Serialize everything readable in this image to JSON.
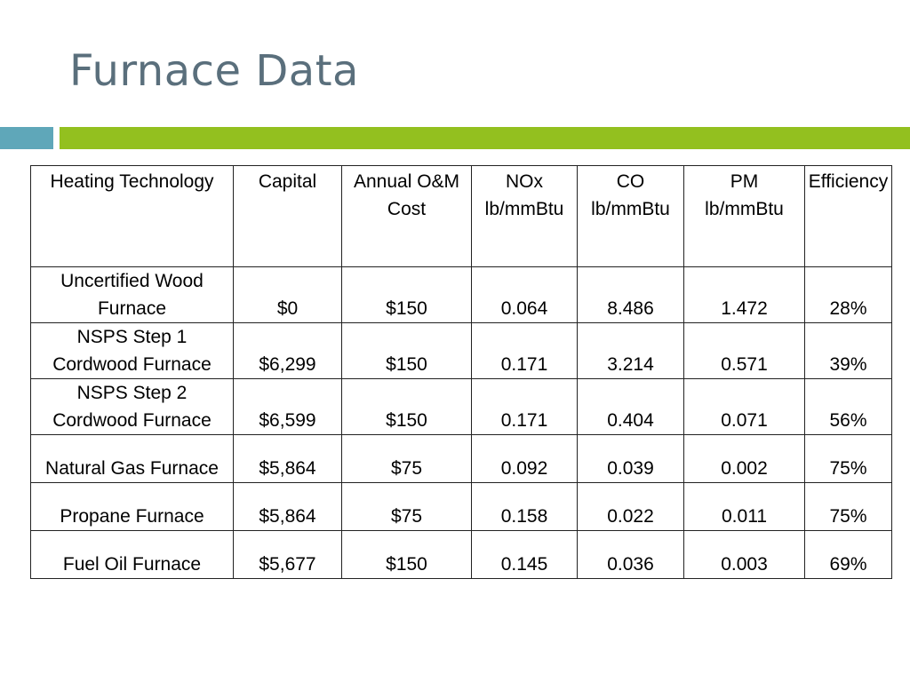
{
  "slide": {
    "title": "Furnace Data"
  },
  "table": {
    "headers": [
      "Heating Technology",
      "Capital",
      "Annual O&M\nCost",
      "NOx\nlb/mmBtu",
      "CO\nlb/mmBtu",
      "PM\nlb/mmBtu",
      "Efficiency"
    ],
    "rows": [
      [
        "Uncertified Wood\nFurnace",
        "$0",
        "$150",
        "0.064",
        "8.486",
        "1.472",
        "28%"
      ],
      [
        "NSPS Step 1\nCordwood Furnace",
        "$6,299",
        "$150",
        "0.171",
        "3.214",
        "0.571",
        "39%"
      ],
      [
        "NSPS Step 2\nCordwood Furnace",
        "$6,599",
        "$150",
        "0.171",
        "0.404",
        "0.071",
        "56%"
      ],
      [
        "Natural Gas Furnace",
        "$5,864",
        "$75",
        "0.092",
        "0.039",
        "0.002",
        "75%"
      ],
      [
        "Propane Furnace",
        "$5,864",
        "$75",
        "0.158",
        "0.022",
        "0.011",
        "75%"
      ],
      [
        "Fuel Oil Furnace",
        "$5,677",
        "$150",
        "0.145",
        "0.036",
        "0.003",
        "69%"
      ]
    ]
  },
  "colors": {
    "title": "#5a6f7c",
    "accent_teal": "#5fa7b9",
    "accent_green": "#93c01f"
  }
}
